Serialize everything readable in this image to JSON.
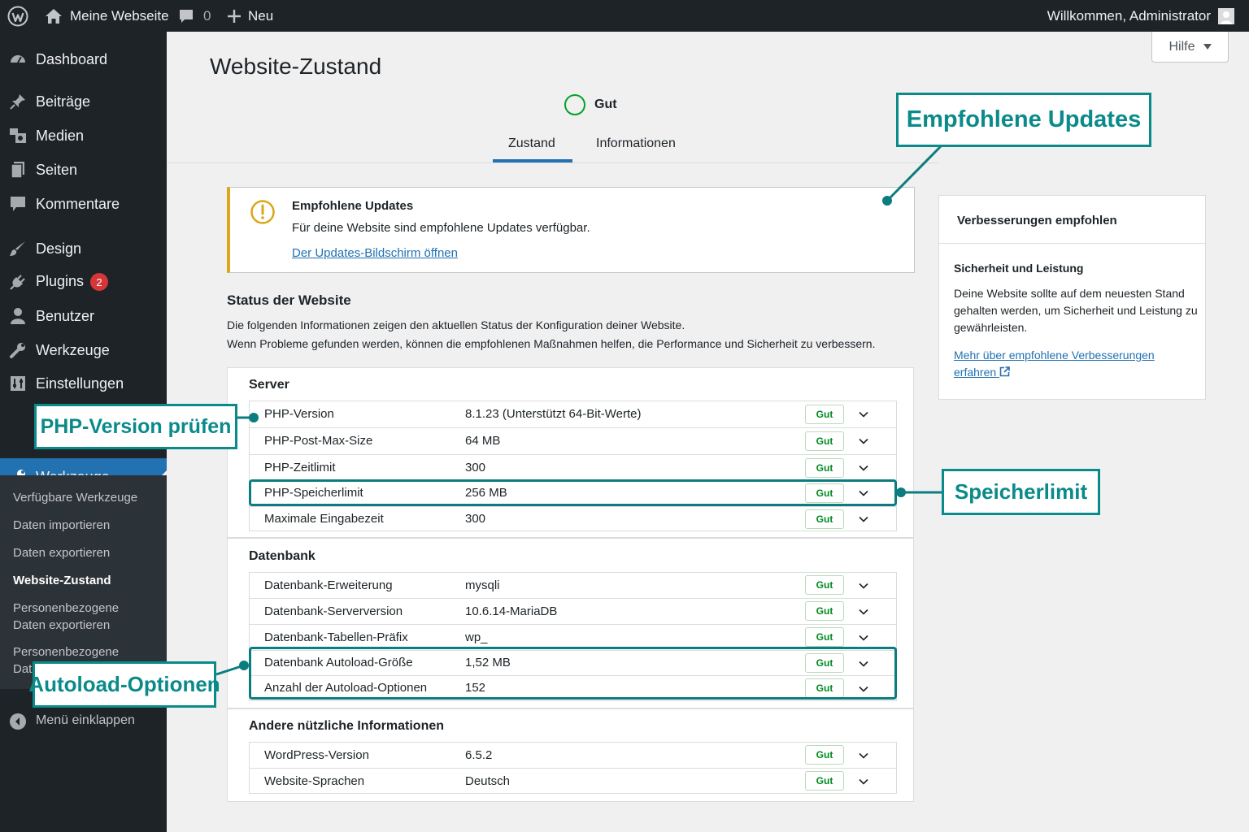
{
  "adminbar": {
    "site_name": "Meine Webseite",
    "comments_count": "0",
    "new_label": "Neu",
    "welcome": "Willkommen, Administrator"
  },
  "sidebar": {
    "items": [
      {
        "label": "Dashboard",
        "icon": "dashboard-icon"
      },
      {
        "label": "Beiträge",
        "icon": "pin-icon"
      },
      {
        "label": "Medien",
        "icon": "media-icon"
      },
      {
        "label": "Seiten",
        "icon": "pages-icon"
      },
      {
        "label": "Kommentare",
        "icon": "comment-icon"
      },
      {
        "label": "Design",
        "icon": "brush-icon"
      },
      {
        "label": "Plugins",
        "icon": "plug-icon",
        "badge": "2"
      },
      {
        "label": "Benutzer",
        "icon": "user-icon"
      },
      {
        "label": "Werkzeuge",
        "icon": "wrench-icon"
      },
      {
        "label": "Einstellungen",
        "icon": "settings-icon"
      }
    ],
    "active_item": {
      "label": "Werkzeuge",
      "icon": "wrench-icon"
    },
    "submenu": [
      "Verfügbare Werkzeuge",
      "Daten importieren",
      "Daten exportieren",
      "Website-Zustand",
      "Personenbezogene Daten exportieren",
      "Personenbezogene Daten löschen"
    ],
    "submenu_current": "Website-Zustand",
    "collapse_label": "Menü einklappen"
  },
  "page": {
    "title": "Website-Zustand",
    "help_label": "Hilfe",
    "score_label": "Gut",
    "tabs": [
      "Zustand",
      "Informationen"
    ],
    "active_tab": "Zustand"
  },
  "notice": {
    "title": "Empfohlene Updates",
    "desc": "Für deine Website sind empfohlene Updates verfügbar.",
    "link": "Der Updates-Bildschirm öffnen"
  },
  "status": {
    "heading": "Status der Website",
    "intro1": "Die folgenden Informationen zeigen den aktuellen Status der Konfiguration deiner Website.",
    "intro2": "Wenn Probleme gefunden werden, können die empfohlenen Maßnahmen helfen, die Performance und Sicherheit zu verbessern."
  },
  "sections": {
    "server": {
      "title": "Server",
      "rows": [
        {
          "key": "PHP-Version",
          "value": "8.1.23 (Unterstützt 64-Bit-Werte)",
          "badge": "Gut"
        },
        {
          "key": "PHP-Post-Max-Size",
          "value": "64 MB",
          "badge": "Gut"
        },
        {
          "key": "PHP-Zeitlimit",
          "value": "300",
          "badge": "Gut"
        },
        {
          "key": "PHP-Speicherlimit",
          "value": "256 MB",
          "badge": "Gut"
        },
        {
          "key": "Maximale Eingabezeit",
          "value": "300",
          "badge": "Gut"
        }
      ]
    },
    "database": {
      "title": "Datenbank",
      "rows": [
        {
          "key": "Datenbank-Erweiterung",
          "value": "mysqli",
          "badge": "Gut"
        },
        {
          "key": "Datenbank-Serverversion",
          "value": "10.6.14-MariaDB",
          "badge": "Gut"
        },
        {
          "key": "Datenbank-Tabellen-Präfix",
          "value": "wp_",
          "badge": "Gut"
        },
        {
          "key": "Datenbank Autoload-Größe",
          "value": "1,52 MB",
          "badge": "Gut"
        },
        {
          "key": "Anzahl der Autoload-Optionen",
          "value": "152",
          "badge": "Gut"
        }
      ]
    },
    "other": {
      "title": "Andere nützliche Informationen",
      "rows": [
        {
          "key": "WordPress-Version",
          "value": "6.5.2",
          "badge": "Gut"
        },
        {
          "key": "Website-Sprachen",
          "value": "Deutsch",
          "badge": "Gut"
        }
      ]
    }
  },
  "rightcard": {
    "header": "Verbesserungen empfohlen",
    "subtitle": "Sicherheit und Leistung",
    "text": "Deine Website sollte auf dem neuesten Stand gehalten werden, um Sicherheit und Leistung zu gewährleisten.",
    "link": "Mehr über empfohlene Verbesserungen erfahren"
  },
  "callouts": {
    "updates": "Empfohlene Updates",
    "php": "PHP-Version prüfen",
    "memory": "Speicherlimit",
    "autoload": "Autoload-Optionen"
  },
  "colors": {
    "adminbar": "#1d2327",
    "accent": "#2271b1",
    "good": "#00a32a",
    "warning": "#dba617",
    "callout": "#0b8a8a",
    "badge": "#d63638"
  }
}
